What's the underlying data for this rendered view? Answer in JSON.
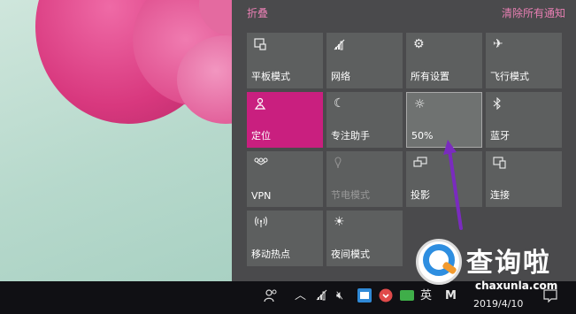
{
  "header": {
    "collapse_label": "折叠",
    "clear_all_label": "清除所有通知"
  },
  "tiles": [
    {
      "label": "平板模式",
      "icon": "tablet-mode-icon"
    },
    {
      "label": "网络",
      "icon": "network-icon"
    },
    {
      "label": "所有设置",
      "icon": "settings-gear-icon"
    },
    {
      "label": "飞行模式",
      "icon": "airplane-icon"
    },
    {
      "label": "定位",
      "icon": "location-icon",
      "state": "active"
    },
    {
      "label": "专注助手",
      "icon": "moon-icon"
    },
    {
      "label": "50%",
      "icon": "brightness-icon",
      "state": "highlighted"
    },
    {
      "label": "蓝牙",
      "icon": "bluetooth-icon"
    },
    {
      "label": "VPN",
      "icon": "vpn-icon"
    },
    {
      "label": "节电模式",
      "icon": "battery-saver-icon",
      "state": "disabled"
    },
    {
      "label": "投影",
      "icon": "project-icon"
    },
    {
      "label": "连接",
      "icon": "connect-icon"
    },
    {
      "label": "移动热点",
      "icon": "hotspot-icon"
    },
    {
      "label": "夜间模式",
      "icon": "night-light-icon"
    }
  ],
  "taskbar": {
    "ime_label": "英",
    "ime_mode": "M",
    "date": "2019/4/10"
  },
  "watermark": {
    "title": "查询啦",
    "subtitle": "chaxunla.com"
  },
  "colors": {
    "accent": "#c91f7f",
    "link": "#e87fb3",
    "panel": "#4a4a4c",
    "tile": "#5d5f5f",
    "arrow": "#7a2bbf"
  }
}
